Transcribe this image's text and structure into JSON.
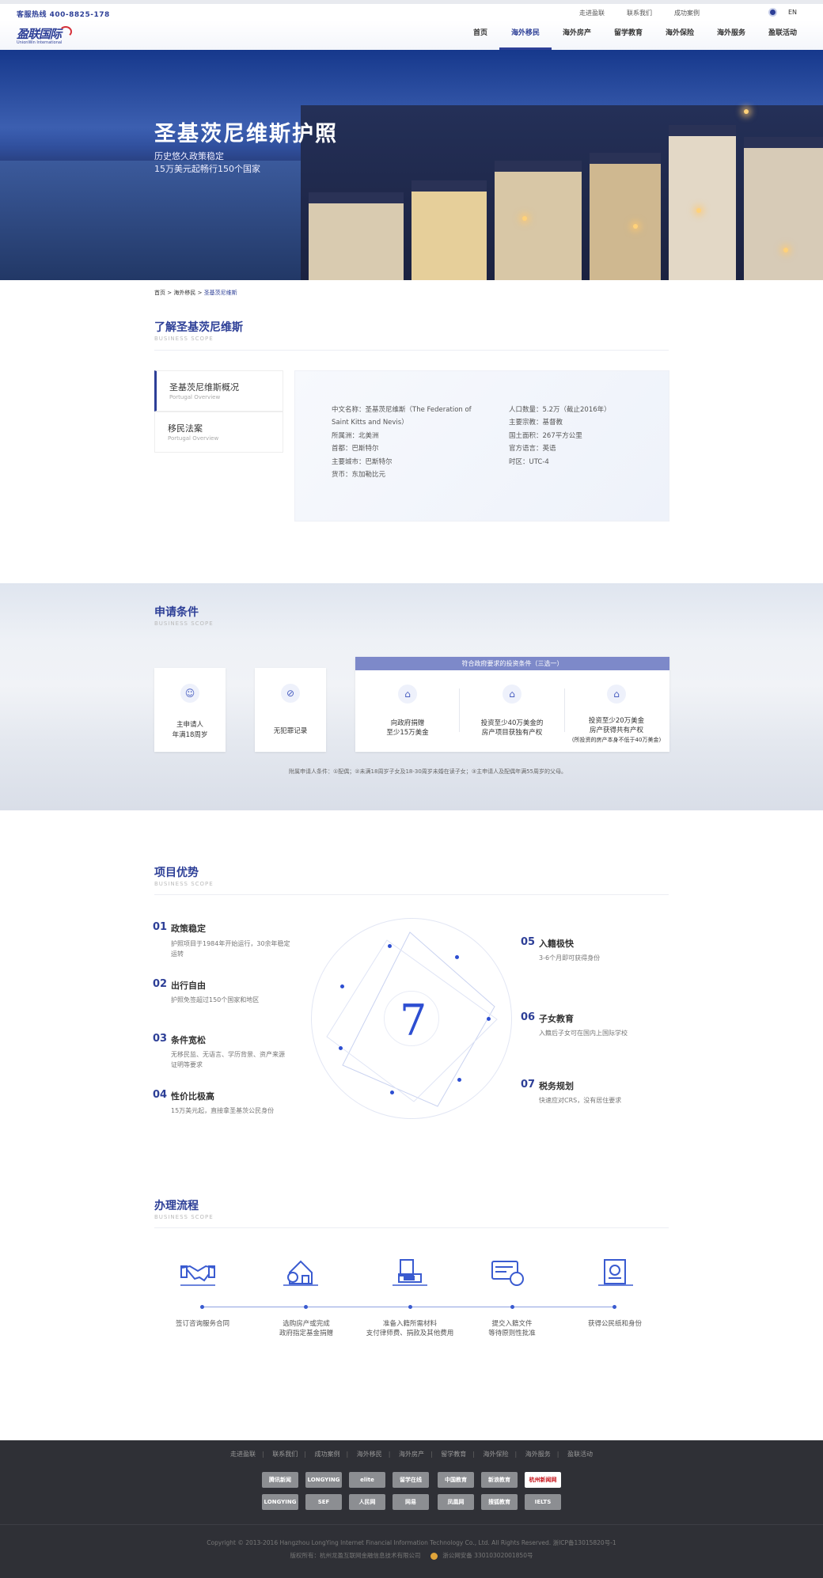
{
  "topbar": {
    "hotline": "客服热线  400-8825-178",
    "links": [
      "走进盈联",
      "联系我们",
      "成功案例"
    ],
    "lang": "EN"
  },
  "logo": {
    "cn": "盈联国际",
    "en": "UnionWin International"
  },
  "nav": [
    "首页",
    "海外移民",
    "海外房产",
    "留学教育",
    "海外保险",
    "海外服务",
    "盈联活动"
  ],
  "hero": {
    "title": "圣基茨尼维斯护照",
    "line1": "历史悠久政策稳定",
    "line2": "15万美元起畅行150个国家"
  },
  "breadcrumb": {
    "home": "首页",
    "sep": ">",
    "level2": "海外移民",
    "current": "圣基茨尼维斯"
  },
  "overview": {
    "title": "了解圣基茨尼维斯",
    "subtitle": "BUSINESS SCOPE",
    "tabs": [
      {
        "label": "圣基茨尼维斯概况",
        "sub": "Portugal Overview"
      },
      {
        "label": "移民法案",
        "sub": "Portugal Overview"
      }
    ],
    "left": [
      "中文名称：圣基茨尼维斯（The Federation of",
      "Saint Kitts and Nevis）",
      "所属洲：北美洲",
      "首都：巴斯特尔",
      "主要城市：巴斯特尔",
      "货币：东加勒比元"
    ],
    "right": [
      "人口数量：5.2万（截止2016年）",
      "主要宗教：基督教",
      "国土面积：267平方公里",
      "官方语言：英语",
      "时区：UTC-4"
    ]
  },
  "conditions": {
    "title": "申请条件",
    "subtitle": "BUSINESS SCOPE",
    "card1": {
      "l1": "主申请人",
      "l2": "年满18周岁"
    },
    "card2": {
      "l1": "无犯罪记录"
    },
    "group_header": "符合政府要求的投资条件（三选一）",
    "opt1": {
      "l1": "向政府捐赠",
      "l2": "至少15万美金"
    },
    "opt2": {
      "l1": "投资至少40万美金的",
      "l2": "房产项目获独有产权"
    },
    "opt3": {
      "l1": "投资至少20万美金",
      "l2": "房产获得共有产权",
      "l3": "(所投资的房产本身不低于40万美金)"
    },
    "note": "附属申请人条件：①配偶；②未满18周岁子女及18-30周岁未婚在读子女；③主申请人及配偶年满55周岁的父母。"
  },
  "advantages": {
    "title": "项目优势",
    "subtitle": "BUSINESS SCOPE",
    "center": "7",
    "items": [
      {
        "num": "01",
        "title": "政策稳定",
        "desc1": "护照项目于1984年开始运行，30余年稳定",
        "desc2": "运转"
      },
      {
        "num": "02",
        "title": "出行自由",
        "desc1": "护照免签超过150个国家和地区",
        "desc2": ""
      },
      {
        "num": "03",
        "title": "条件宽松",
        "desc1": "无移民监、无语言、学历背景、资产来源",
        "desc2": "证明等要求"
      },
      {
        "num": "04",
        "title": "性价比极高",
        "desc1": "15万美元起，直接拿圣基茨公民身份",
        "desc2": ""
      },
      {
        "num": "05",
        "title": "入籍极快",
        "desc1": "3-6个月即可获得身份",
        "desc2": ""
      },
      {
        "num": "06",
        "title": "子女教育",
        "desc1": "入籍后子女可在国内上国际学校",
        "desc2": ""
      },
      {
        "num": "07",
        "title": "税务规划",
        "desc1": "快速应对CRS，没有居住要求",
        "desc2": ""
      }
    ]
  },
  "process": {
    "title": "办理流程",
    "subtitle": "BUSINESS SCOPE",
    "steps": [
      {
        "icon": "handshake-icon",
        "l1": "签订咨询服务合同",
        "l2": ""
      },
      {
        "icon": "house-money-icon",
        "l1": "选购房产或完成",
        "l2": "政府指定基金捐赠"
      },
      {
        "icon": "documents-icon",
        "l1": "准备入籍所需材料",
        "l2": "支付律师费、捐款及其他费用"
      },
      {
        "icon": "card-stamp-icon",
        "l1": "提交入籍文件",
        "l2": "等待原则性批准"
      },
      {
        "icon": "passport-icon",
        "l1": "获得公民纸和身份",
        "l2": ""
      }
    ]
  },
  "footer": {
    "links": [
      "走进盈联",
      "联系我们",
      "成功案例",
      "海外移民",
      "海外房产",
      "留学教育",
      "海外保险",
      "海外服务",
      "盈联活动"
    ],
    "partners_row1": [
      "腾讯新闻",
      "LONGYING",
      "elite",
      "留学在线",
      "中国教育",
      "新浪教育",
      "杭州新闻网"
    ],
    "partners_row2": [
      "LONGYING",
      "SEF",
      "人民网",
      "网易",
      "凤凰网",
      "搜狐教育",
      "IELTS"
    ],
    "copyright": "Copyright © 2013-2016 Hangzhou LongYing Internet Financial Information Technology Co., Ltd. All Rights Reserved. 浙ICP备13015820号-1",
    "owner": "版权所有：杭州龙盈互联网金融信息技术有限公司",
    "police": "浙公网安备 33010302001850号"
  },
  "colors": {
    "brand": "#2d3f97",
    "accent": "#2d4ed1",
    "footer": "#2f3036"
  }
}
